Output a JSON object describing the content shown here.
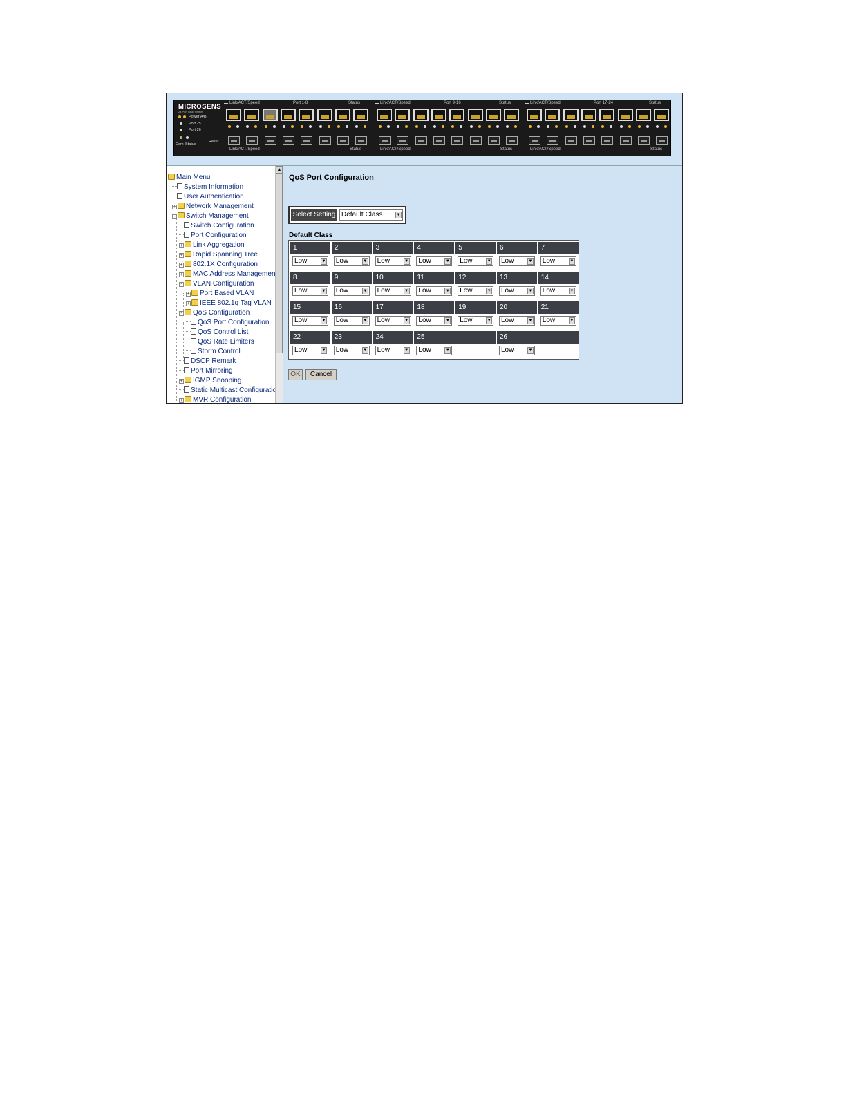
{
  "device": {
    "brand": "MICROSENS",
    "model": "24 Port GBE Switch",
    "led_power": "Power A/B",
    "led_port25": "Port 25",
    "led_port26": "Port 26",
    "com": "Com",
    "status": "Status",
    "reset": "Reset",
    "groups": [
      {
        "top_left": "Link/ACT/Speed",
        "range": "Port 1-8",
        "top_right": "Status",
        "bottom_left": "Link/ACT/Speed",
        "bottom_right": "Status"
      },
      {
        "top_left": "Link/ACT/Speed",
        "range": "Port 9-16",
        "top_right": "Status",
        "bottom_left": "Link/ACT/Speed",
        "bottom_right": "Status"
      },
      {
        "top_left": "Link/ACT/Speed",
        "range": "Port 17-24",
        "top_right": "Status",
        "bottom_left": "Link/ACT/Speed",
        "bottom_right": "Status"
      }
    ]
  },
  "sidebar": {
    "items": [
      {
        "label": "Main Menu",
        "type": "folder",
        "level": 0,
        "expander": ""
      },
      {
        "label": "System Information",
        "type": "doc",
        "level": 1,
        "expander": ""
      },
      {
        "label": "User Authentication",
        "type": "doc",
        "level": 1,
        "expander": ""
      },
      {
        "label": "Network Management",
        "type": "folder",
        "level": 1,
        "expander": "+"
      },
      {
        "label": "Switch Management",
        "type": "folder",
        "level": 1,
        "expander": "-"
      },
      {
        "label": "Switch Configuration",
        "type": "doc",
        "level": 2,
        "expander": ""
      },
      {
        "label": "Port Configuration",
        "type": "doc",
        "level": 2,
        "expander": ""
      },
      {
        "label": "Link Aggregation",
        "type": "folder",
        "level": 2,
        "expander": "+"
      },
      {
        "label": "Rapid Spanning Tree",
        "type": "folder",
        "level": 2,
        "expander": "+"
      },
      {
        "label": "802.1X Configuration",
        "type": "folder",
        "level": 2,
        "expander": "+"
      },
      {
        "label": "MAC Address Managemen",
        "type": "folder",
        "level": 2,
        "expander": "+"
      },
      {
        "label": "VLAN Configuration",
        "type": "folder",
        "level": 2,
        "expander": "-"
      },
      {
        "label": "Port Based VLAN",
        "type": "folder",
        "level": 3,
        "expander": "+"
      },
      {
        "label": "IEEE 802.1q Tag VLAN",
        "type": "folder",
        "level": 3,
        "expander": "+"
      },
      {
        "label": "QoS Configuration",
        "type": "folder",
        "level": 2,
        "expander": "-"
      },
      {
        "label": "QoS Port Configuration",
        "type": "doc",
        "level": 3,
        "expander": ""
      },
      {
        "label": "QoS Control List",
        "type": "doc",
        "level": 3,
        "expander": ""
      },
      {
        "label": "QoS Rate Limiters",
        "type": "doc",
        "level": 3,
        "expander": ""
      },
      {
        "label": "Storm Control",
        "type": "doc",
        "level": 3,
        "expander": ""
      },
      {
        "label": "DSCP Remark",
        "type": "doc",
        "level": 2,
        "expander": ""
      },
      {
        "label": "Port Mirroring",
        "type": "doc",
        "level": 2,
        "expander": ""
      },
      {
        "label": "IGMP Snooping",
        "type": "folder",
        "level": 2,
        "expander": "+"
      },
      {
        "label": "Static Multicast Configuratio",
        "type": "doc",
        "level": 2,
        "expander": ""
      },
      {
        "label": "MVR Configuration",
        "type": "folder",
        "level": 2,
        "expander": "+"
      }
    ]
  },
  "main": {
    "title": "QoS Port Configuration",
    "select_setting_label": "Select Setting",
    "select_setting_value": "Default Class",
    "section_label": "Default Class",
    "ports": [
      {
        "port": "1",
        "value": "Low"
      },
      {
        "port": "2",
        "value": "Low"
      },
      {
        "port": "3",
        "value": "Low"
      },
      {
        "port": "4",
        "value": "Low"
      },
      {
        "port": "5",
        "value": "Low"
      },
      {
        "port": "6",
        "value": "Low"
      },
      {
        "port": "7",
        "value": "Low"
      },
      {
        "port": "8",
        "value": "Low"
      },
      {
        "port": "9",
        "value": "Low"
      },
      {
        "port": "10",
        "value": "Low"
      },
      {
        "port": "11",
        "value": "Low"
      },
      {
        "port": "12",
        "value": "Low"
      },
      {
        "port": "13",
        "value": "Low"
      },
      {
        "port": "14",
        "value": "Low"
      },
      {
        "port": "15",
        "value": "Low"
      },
      {
        "port": "16",
        "value": "Low"
      },
      {
        "port": "17",
        "value": "Low"
      },
      {
        "port": "18",
        "value": "Low"
      },
      {
        "port": "19",
        "value": "Low"
      },
      {
        "port": "20",
        "value": "Low"
      },
      {
        "port": "21",
        "value": "Low"
      },
      {
        "port": "22",
        "value": "Low"
      },
      {
        "port": "23",
        "value": "Low"
      },
      {
        "port": "24",
        "value": "Low"
      },
      {
        "port": "25",
        "value": "Low"
      },
      {
        "port": "26",
        "value": "Low"
      }
    ],
    "ok_label": "OK",
    "cancel_label": "Cancel"
  }
}
